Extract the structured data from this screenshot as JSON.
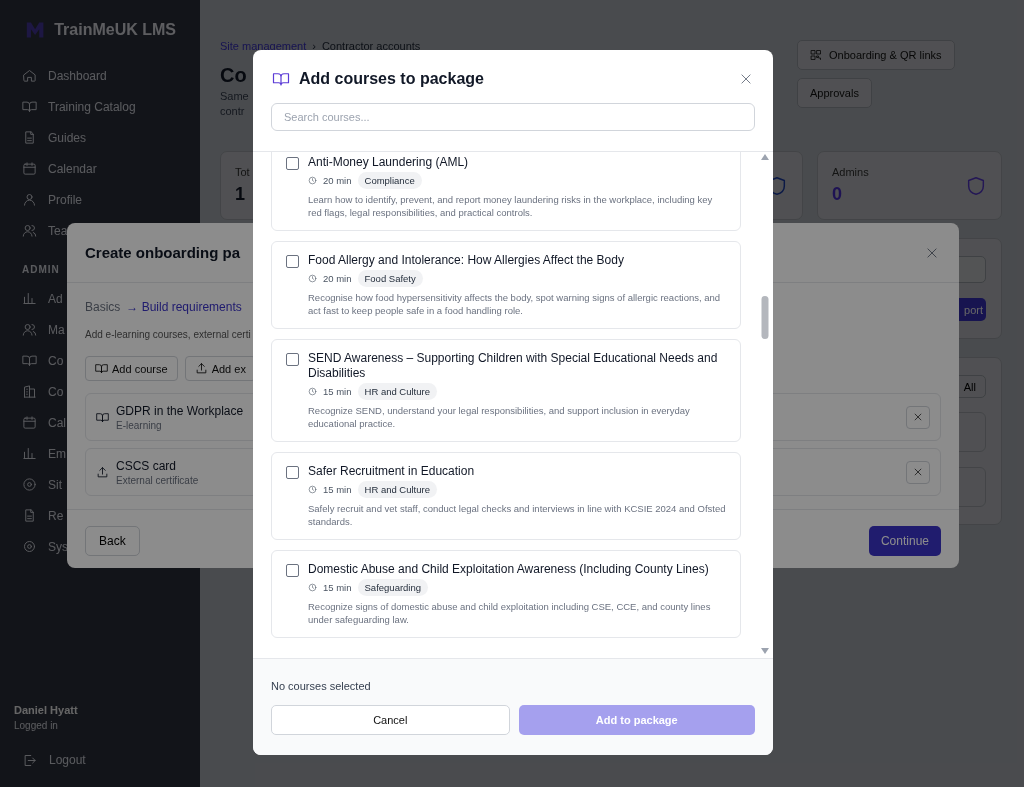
{
  "sidebar": {
    "brand": "TrainMeUK LMS",
    "items": [
      {
        "label": "Dashboard"
      },
      {
        "label": "Training Catalog"
      },
      {
        "label": "Guides"
      },
      {
        "label": "Calendar"
      },
      {
        "label": "Profile"
      },
      {
        "label": "Tea"
      }
    ],
    "admin_heading": "ADMIN",
    "admin_items": [
      {
        "label": "Ad"
      },
      {
        "label": "Ma"
      },
      {
        "label": "Co"
      },
      {
        "label": "Co"
      },
      {
        "label": "Cal"
      },
      {
        "label": "Em"
      },
      {
        "label": "Sit"
      },
      {
        "label": "Re"
      },
      {
        "label": "Sys"
      }
    ],
    "user": {
      "name": "Daniel Hyatt",
      "status": "Logged in"
    },
    "logout": "Logout"
  },
  "page": {
    "breadcrumb": [
      "Site management",
      "Contractor accounts"
    ],
    "breadcrumb_separator": "›",
    "title": "Co",
    "description_lines": [
      "Same",
      "contr"
    ],
    "actions": [
      "Onboarding & QR links",
      "Approvals"
    ],
    "stats": [
      {
        "label": "Tot",
        "value": "1"
      },
      {
        "label": "Admins",
        "value": "0"
      }
    ],
    "panel_button": "port",
    "filter_button": "All"
  },
  "onboarding_modal": {
    "title": "Create onboarding pa",
    "steps": [
      {
        "label": "Basics",
        "selected": false
      },
      {
        "label": "→ Build requirements",
        "selected": true
      }
    ],
    "description": "Add e-learning courses, external certi",
    "add_buttons": [
      {
        "label": "Add course",
        "kind": "course"
      },
      {
        "label": "Add ex",
        "kind": "certificate"
      }
    ],
    "requirements": [
      {
        "name": "GDPR in the Workplace",
        "type": "E-learning",
        "kind": "course"
      },
      {
        "name": "CSCS card",
        "type": "External certificate",
        "kind": "certificate"
      }
    ],
    "back": "Back",
    "continue": "Continue"
  },
  "course_modal": {
    "title": "Add courses to package",
    "search": {
      "placeholder": "Search courses..."
    },
    "courses": [
      {
        "title": "Anti-Money Laundering (AML)",
        "duration": "20 min",
        "category": "Compliance",
        "description": "Learn how to identify, prevent, and report money laundering risks in the workplace, including key red flags, legal responsibilities, and practical controls.",
        "checked": false
      },
      {
        "title": "Food Allergy and Intolerance: How Allergies Affect the Body",
        "duration": "20 min",
        "category": "Food Safety",
        "description": "Recognise how food hypersensitivity affects the body, spot warning signs of allergic reactions, and act fast to keep people safe in a food handling role.",
        "checked": false
      },
      {
        "title": "SEND Awareness – Supporting Children with Special Educational Needs and Disabilities",
        "duration": "15 min",
        "category": "HR and Culture",
        "description": "Recognize SEND, understand your legal responsibilities, and support inclusion in everyday educational practice.",
        "checked": false
      },
      {
        "title": "Safer Recruitment in Education",
        "duration": "15 min",
        "category": "HR and Culture",
        "description": "Safely recruit and vet staff, conduct legal checks and interviews in line with KCSIE 2024 and Ofsted standards.",
        "checked": false
      },
      {
        "title": "Domestic Abuse and Child Exploitation Awareness (Including County Lines)",
        "duration": "15 min",
        "category": "Safeguarding",
        "description": "Recognize signs of domestic abuse and child exploitation including CSE, CCE, and county lines under safeguarding law.",
        "checked": false
      }
    ],
    "selection_status": "No courses selected",
    "cancel": "Cancel",
    "add": {
      "label": "Add to package",
      "disabled": true
    }
  }
}
